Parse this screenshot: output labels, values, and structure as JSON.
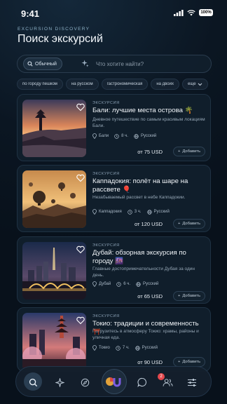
{
  "status": {
    "time": "9:41",
    "battery": "100%"
  },
  "header": {
    "eyebrow": "EXCURSION DISCOVERY",
    "title": "Поиск экскурсий"
  },
  "search": {
    "mode": "Обычный",
    "placeholder": "Что хотите найти?"
  },
  "chips": [
    "по городу пешком",
    "на русском",
    "гастрономическая",
    "на двоих",
    "еще"
  ],
  "cards": [
    {
      "kind": "ЭКСКУРСИЯ",
      "title": "Бали: лучшие места острова 🌴",
      "desc": "Дневное путешествие по самым красивым локациям Бали.",
      "place": "Бали",
      "duration": "8 ч.",
      "lang": "Русский",
      "price": "от 75 USD",
      "add": "Добавить"
    },
    {
      "kind": "ЭКСКУРСИЯ",
      "title": "Каппадокия: полёт на шаре на рассвете 🎈",
      "desc": "Незабываемый рассвет в небе Каппадокии.",
      "place": "Каппадокия",
      "duration": "3 ч.",
      "lang": "Русский",
      "price": "от 120 USD",
      "add": "Добавить"
    },
    {
      "kind": "ЭКСКУРСИЯ",
      "title": "Дубай: обзорная экскурсия по городу 🌆",
      "desc": "Главные достопримечательности Дубая за один день.",
      "place": "Дубай",
      "duration": "6 ч.",
      "lang": "Русский",
      "price": "от 65 USD",
      "add": "Добавить"
    },
    {
      "kind": "ЭКСКУРСИЯ",
      "title": "Токио: традиции и современность ⛩️",
      "desc": "Погрузитесь в атмосферу Токио: храмы, районы и уличная еда.",
      "place": "Токио",
      "duration": "7 ч.",
      "lang": "Русский",
      "price": "от 90 USD",
      "add": "Добавить"
    }
  ],
  "nav": {
    "center_label": "GU",
    "chat_badge": "2"
  },
  "colors": {
    "accent": "#e5484d",
    "background": "#0a1420",
    "card": "#101e2b"
  }
}
